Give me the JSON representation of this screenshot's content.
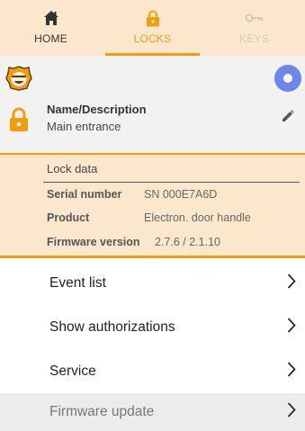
{
  "tabs": [
    {
      "label": "HOME",
      "icon": "home-icon",
      "active": false
    },
    {
      "label": "LOCKS",
      "icon": "lock-icon",
      "active": true
    },
    {
      "label": "KEYS",
      "icon": "key-icon",
      "active": false
    }
  ],
  "header": {
    "name_label": "Name/Description",
    "name_value": "Main entrance"
  },
  "lock_data": {
    "title": "Lock data",
    "rows": [
      {
        "key": "Serial number",
        "value": "SN 000E7A6D"
      },
      {
        "key": "Product",
        "value": "Electron. door handle"
      },
      {
        "key": "Firmware version",
        "value": "2.7.6 / 2.1.10"
      }
    ]
  },
  "menu": [
    {
      "label": "Event list"
    },
    {
      "label": "Show authorizations"
    },
    {
      "label": "Service"
    },
    {
      "label": "Firmware update",
      "disabled": true
    }
  ],
  "colors": {
    "accent": "#f29d0e",
    "tab_bg": "#fbe7cc",
    "fab": "#6e86e8",
    "header_bg": "#f2f2f2"
  }
}
